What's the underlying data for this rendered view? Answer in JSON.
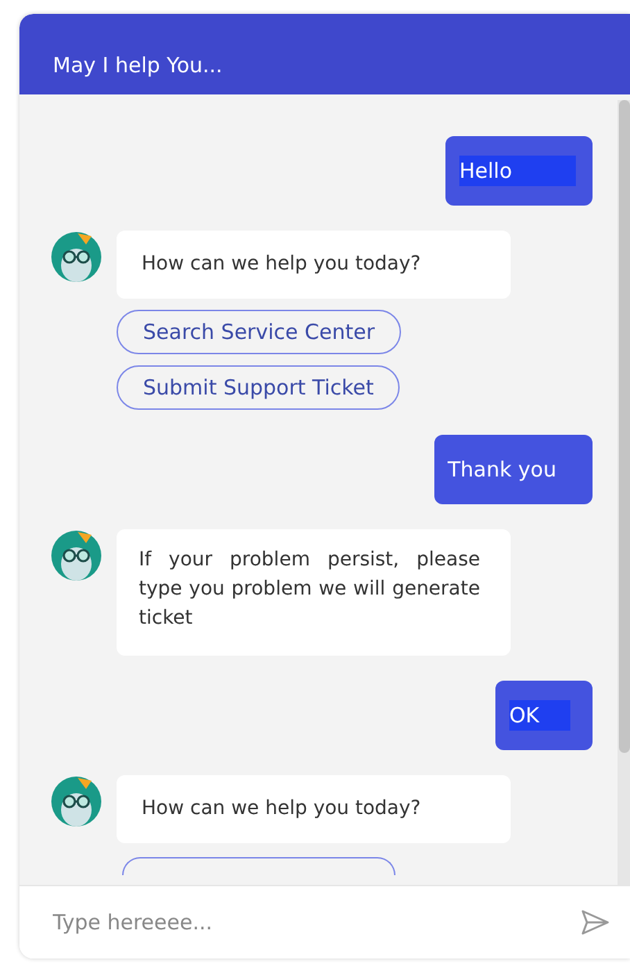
{
  "header": {
    "title": "May I help You..."
  },
  "messages": [
    {
      "kind": "user",
      "text": "Hello",
      "highlighted": true
    },
    {
      "kind": "bot",
      "text": "How can we help you today?",
      "justified": false,
      "options": [
        "Search Service Center",
        "Submit Support Ticket"
      ]
    },
    {
      "kind": "user",
      "text": "Thank you",
      "highlighted": false
    },
    {
      "kind": "bot",
      "text": "If your problem persist, please type you problem we will generate ticket",
      "justified": true
    },
    {
      "kind": "user",
      "text": "OK",
      "highlighted": true
    },
    {
      "kind": "bot",
      "text": "How can we help you today?",
      "justified": false,
      "cut_option": true
    }
  ],
  "composer": {
    "placeholder": "Type hereeee..."
  }
}
